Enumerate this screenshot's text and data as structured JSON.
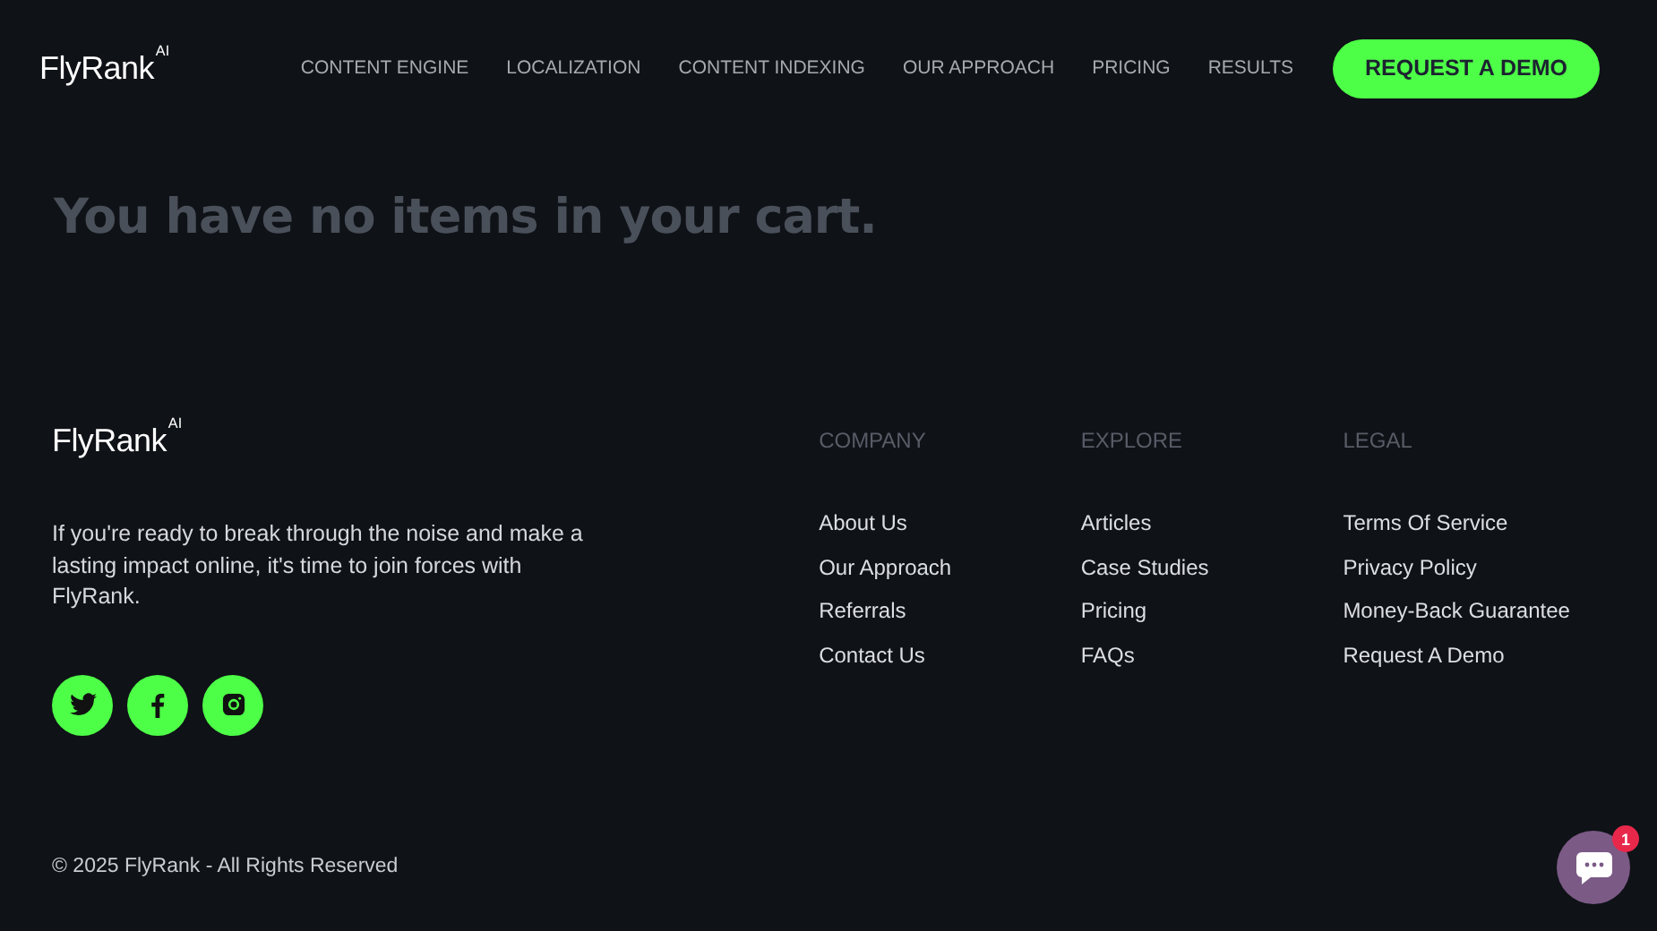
{
  "header": {
    "logo": {
      "name": "FlyRank",
      "badge": "AI"
    },
    "nav": [
      {
        "label": "CONTENT ENGINE"
      },
      {
        "label": "LOCALIZATION"
      },
      {
        "label": "CONTENT INDEXING"
      },
      {
        "label": "OUR APPROACH"
      },
      {
        "label": "PRICING"
      },
      {
        "label": "RESULTS"
      }
    ],
    "cta": "REQUEST A DEMO"
  },
  "main": {
    "heading": "You have no items in your cart."
  },
  "footer": {
    "logo": {
      "name": "FlyRank",
      "badge": "AI"
    },
    "tagline": "If you're ready to break through the noise and make a lasting impact online, it's time to join forces with FlyRank.",
    "social": [
      {
        "kind": "twitter"
      },
      {
        "kind": "facebook"
      },
      {
        "kind": "instagram"
      }
    ],
    "columns": [
      {
        "title": "COMPANY",
        "links": [
          "About Us",
          "Our Approach",
          "Referrals",
          "Contact Us"
        ]
      },
      {
        "title": "EXPLORE",
        "links": [
          "Articles",
          "Case Studies",
          "Pricing",
          "FAQs"
        ]
      },
      {
        "title": "LEGAL",
        "links": [
          "Terms Of Service",
          "Privacy Policy",
          "Money-Back Guarantee",
          "Request A Demo"
        ]
      }
    ],
    "copyright": "© 2025 FlyRank - All Rights Reserved"
  },
  "chat": {
    "badge": "1"
  }
}
